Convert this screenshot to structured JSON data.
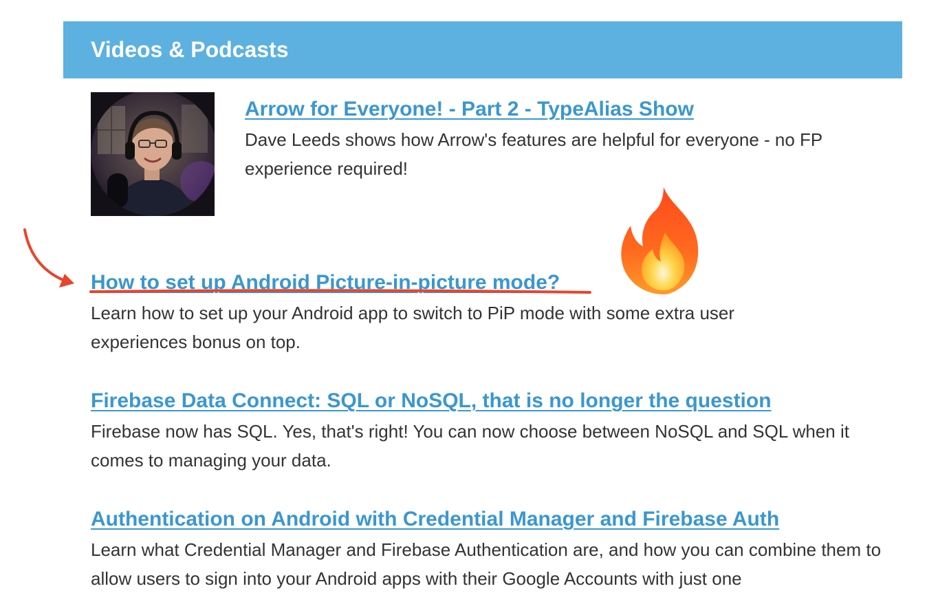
{
  "section": {
    "title": "Videos & Podcasts"
  },
  "items": [
    {
      "title": "Arrow for Everyone! - Part 2 - TypeAlias Show",
      "description": "Dave Leeds shows how Arrow's features are helpful for everyone - no FP experience required!",
      "thumbnail": "host-portrait-thumbnail"
    },
    {
      "title": "How to set up Android Picture-in-picture mode?",
      "description": "Learn how to set up your Android app to switch to PiP mode with some extra user experiences bonus on top.",
      "highlight": {
        "arrow": "curved-arrow-icon",
        "underline": "red-underline",
        "emoji": "fire-icon"
      }
    },
    {
      "title": "Firebase Data Connect: SQL or NoSQL, that is no longer the question",
      "description": "Firebase now has SQL. Yes, that's right! You can now choose between NoSQL and SQL when it comes to managing your data."
    },
    {
      "title": "Authentication on Android with Credential Manager and Firebase Auth",
      "description": "Learn what Credential Manager and Firebase Authentication are, and how you can combine them to allow users to sign into your Android apps with their Google Accounts with just one"
    }
  ],
  "colors": {
    "header_bg": "#5cb1e0",
    "link": "#3a97cf",
    "text": "#333333",
    "annotation": "#e8452c"
  }
}
